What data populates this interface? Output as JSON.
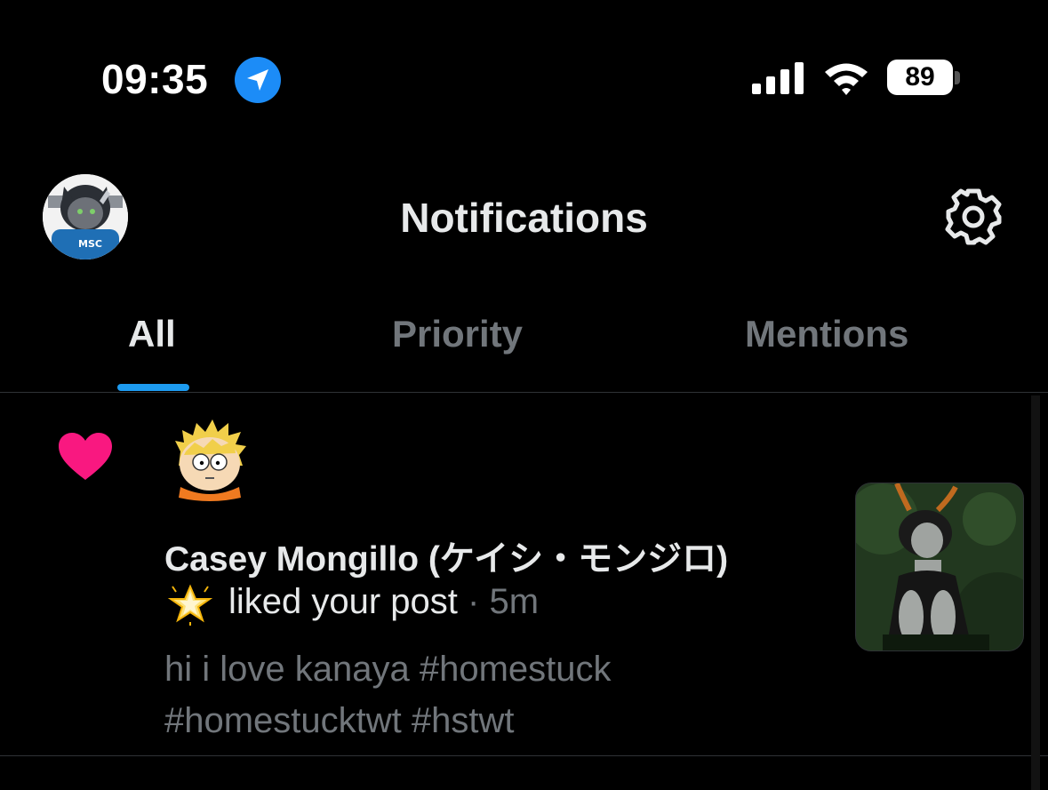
{
  "status_bar": {
    "time": "09:35",
    "battery": "89",
    "icons": [
      "location-arrow-icon",
      "cellular-signal-icon",
      "wifi-icon",
      "battery-icon"
    ]
  },
  "header": {
    "title": "Notifications",
    "avatar_badge": "MSC",
    "icons": [
      "profile-avatar",
      "gear-icon"
    ]
  },
  "tabs": [
    {
      "label": "All",
      "active": true
    },
    {
      "label": "Priority",
      "active": false
    },
    {
      "label": "Mentions",
      "active": false
    }
  ],
  "notification": {
    "type_icon": "heart-icon",
    "name": "Casey Mongillo (ケイシ・モンジロ)",
    "badge_icon": "star-emoji-icon",
    "action": "liked your post",
    "separator": "·",
    "time": "5m",
    "post_text": "hi i love kanaya #homestuck #homestucktwt #hstwt"
  },
  "colors": {
    "background": "#000000",
    "accent": "#1d9bf0",
    "heart": "#f91880",
    "muted": "#71767b",
    "text": "#e7e9ea",
    "location": "#1c8cf7"
  }
}
